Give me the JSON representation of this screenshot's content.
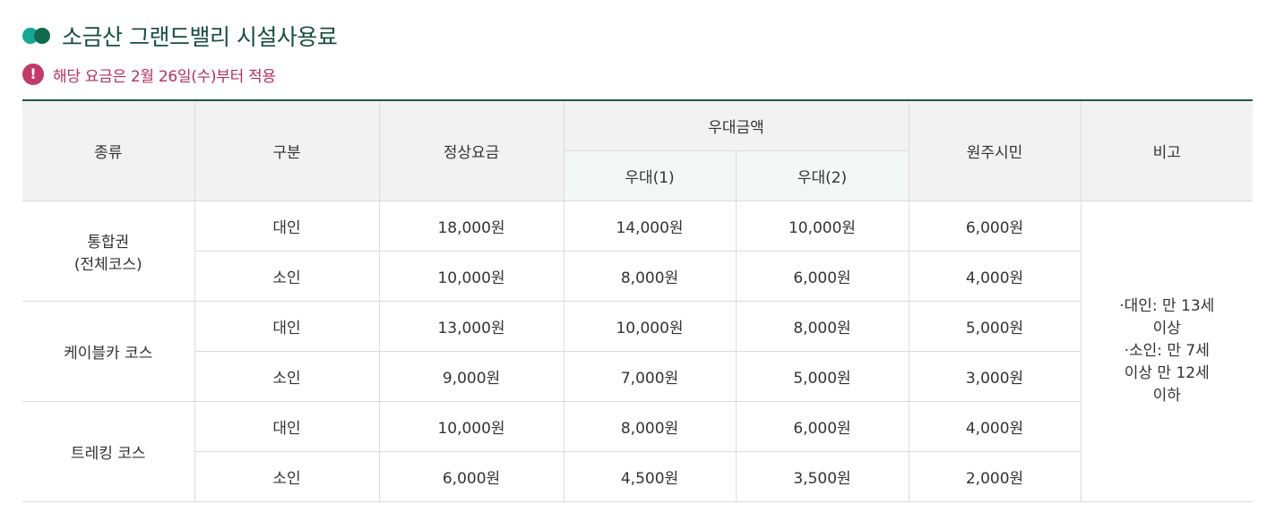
{
  "header": {
    "title": "소금산 그랜드밸리 시설사용료",
    "notice_icon_glyph": "!",
    "notice": "해당 요금은 2월 26일(수)부터 적용"
  },
  "icons": {
    "title": "double-circle-icon",
    "notice": "exclamation-circle-icon"
  },
  "colors": {
    "title": "#16503c",
    "notice": "#b4305e",
    "notice_icon": "#c33a68",
    "dot_light": "#15a892",
    "dot_dark": "#0f6b4e",
    "table_top_border": "#1e5a45"
  },
  "table": {
    "headers": {
      "type": "종류",
      "category": "구분",
      "regular": "정상요금",
      "discount_group": "우대금액",
      "discount1": "우대(1)",
      "discount2": "우대(2)",
      "residents": "원주시민",
      "remarks": "비고"
    },
    "groups": [
      {
        "name_lines": [
          "통합권",
          "(전체코스)"
        ],
        "rows": [
          {
            "category": "대인",
            "regular": "18,000원",
            "discount1": "14,000원",
            "discount2": "10,000원",
            "residents": "6,000원"
          },
          {
            "category": "소인",
            "regular": "10,000원",
            "discount1": "8,000원",
            "discount2": "6,000원",
            "residents": "4,000원"
          }
        ]
      },
      {
        "name_lines": [
          "케이블카 코스"
        ],
        "rows": [
          {
            "category": "대인",
            "regular": "13,000원",
            "discount1": "10,000원",
            "discount2": "8,000원",
            "residents": "5,000원"
          },
          {
            "category": "소인",
            "regular": "9,000원",
            "discount1": "7,000원",
            "discount2": "5,000원",
            "residents": "3,000원"
          }
        ]
      },
      {
        "name_lines": [
          "트레킹 코스"
        ],
        "rows": [
          {
            "category": "대인",
            "regular": "10,000원",
            "discount1": "8,000원",
            "discount2": "6,000원",
            "residents": "4,000원"
          },
          {
            "category": "소인",
            "regular": "6,000원",
            "discount1": "4,500원",
            "discount2": "3,500원",
            "residents": "2,000원"
          }
        ]
      }
    ],
    "remarks_lines": [
      "·대인: 만 13세",
      "이상",
      "·소인: 만 7세",
      "이상 만 12세",
      "이하"
    ]
  }
}
